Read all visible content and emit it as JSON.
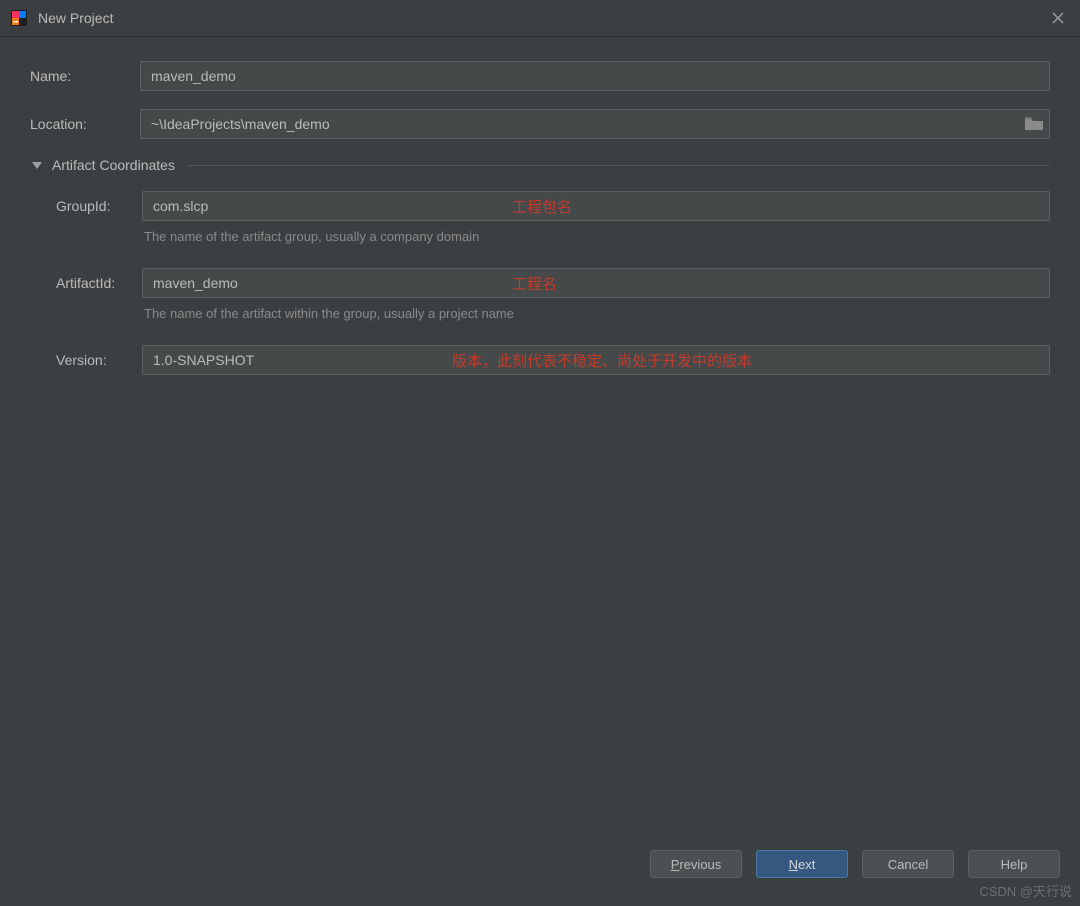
{
  "window": {
    "title": "New Project"
  },
  "fields": {
    "name_label": "Name:",
    "name_value": "maven_demo",
    "location_label": "Location:",
    "location_value": "~\\IdeaProjects\\maven_demo"
  },
  "section": {
    "title": "Artifact Coordinates"
  },
  "artifact": {
    "group_label": "GroupId:",
    "group_value": "com.slcp",
    "group_hint": "The name of the artifact group, usually a company domain",
    "artifact_label": "ArtifactId:",
    "artifact_value": "maven_demo",
    "artifact_hint": "The name of the artifact within the group, usually a project name",
    "version_label": "Version:",
    "version_value": "1.0-SNAPSHOT"
  },
  "annotations": {
    "group": "工程包名",
    "artifact": "工程名",
    "version": "版本，此刻代表不稳定、尚处于开发中的版本"
  },
  "buttons": {
    "previous": "Previous",
    "previous_mn": "P",
    "next": "Next",
    "next_mn": "N",
    "cancel": "Cancel",
    "help": "Help"
  },
  "watermark": "CSDN @天行说"
}
